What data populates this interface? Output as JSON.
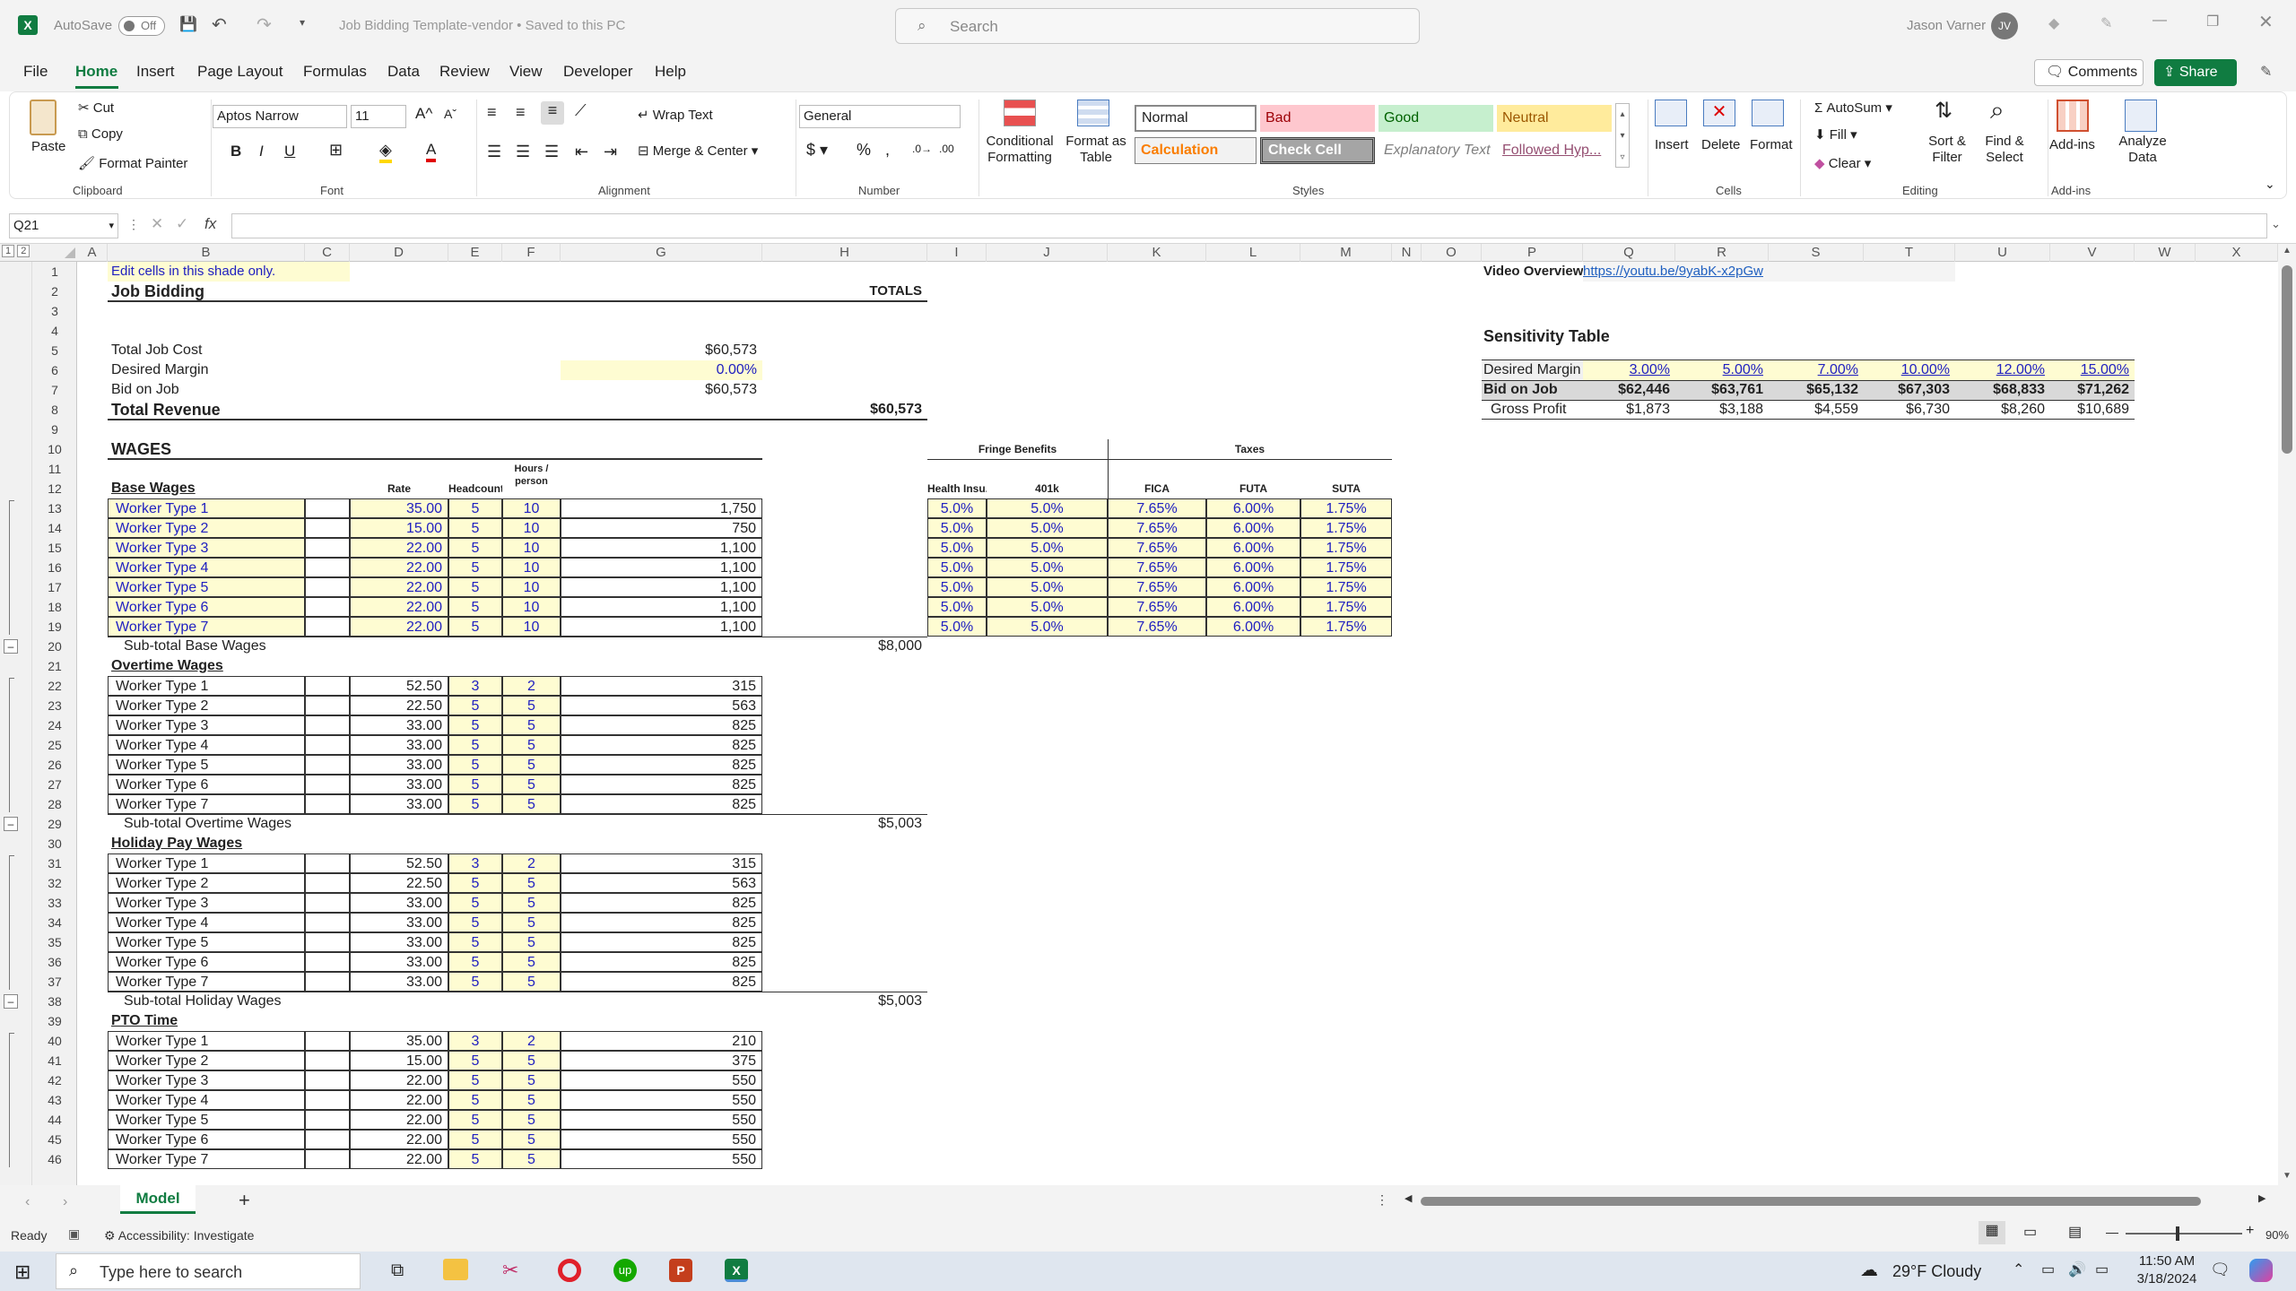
{
  "titlebar": {
    "autosave": "AutoSave",
    "toggle": "Off",
    "doc_title": "Job Bidding Template-vendor • Saved to this PC",
    "search_placeholder": "Search",
    "user": "Jason Varner",
    "initials": "JV"
  },
  "menu": {
    "items": [
      "File",
      "Home",
      "Insert",
      "Page Layout",
      "Formulas",
      "Data",
      "Review",
      "View",
      "Developer",
      "Help"
    ],
    "comments": "Comments",
    "share": "Share"
  },
  "ribbon": {
    "clipboard": {
      "paste": "Paste",
      "cut": "Cut",
      "copy": "Copy",
      "format_painter": "Format Painter",
      "label": "Clipboard"
    },
    "font": {
      "name": "Aptos Narrow",
      "size": "11",
      "label": "Font"
    },
    "alignment": {
      "wrap": "Wrap Text",
      "merge": "Merge & Center",
      "label": "Alignment"
    },
    "number": {
      "format": "General",
      "label": "Number"
    },
    "styles": {
      "cond": "Conditional Formatting",
      "table": "Format as Table",
      "normal": "Normal",
      "bad": "Bad",
      "good": "Good",
      "neutral": "Neutral",
      "calculation": "Calculation",
      "check": "Check Cell",
      "explanatory": "Explanatory Text",
      "followed": "Followed Hyp...",
      "label": "Styles"
    },
    "cells": {
      "insert": "Insert",
      "delete": "Delete",
      "format": "Format",
      "label": "Cells"
    },
    "editing": {
      "autosum": "AutoSum",
      "fill": "Fill",
      "clear": "Clear",
      "sort": "Sort & Filter",
      "find": "Find & Select",
      "label": "Editing"
    },
    "addins": {
      "addins": "Add-ins",
      "analyze": "Analyze Data",
      "label": "Add-ins"
    }
  },
  "formula_bar": {
    "namebox": "Q21",
    "fx": "fx",
    "value": ""
  },
  "columns": [
    "A",
    "B",
    "C",
    "D",
    "E",
    "F",
    "G",
    "H",
    "I",
    "J",
    "K",
    "L",
    "M",
    "N",
    "O",
    "P",
    "Q",
    "R",
    "S",
    "T",
    "U",
    "V",
    "W",
    "X"
  ],
  "rows": [
    1,
    2,
    3,
    4,
    5,
    6,
    7,
    8,
    9,
    10,
    11,
    12,
    13,
    14,
    15,
    16,
    17,
    18,
    19,
    20,
    21,
    22,
    23,
    24,
    25,
    26,
    27,
    28,
    29,
    30,
    31,
    32,
    33,
    34,
    35,
    36,
    37,
    38,
    39,
    40,
    41,
    42,
    43,
    44,
    45,
    46
  ],
  "sheet": {
    "note": "Edit cells in this shade only.",
    "title": "Job Bidding",
    "totals": "TOTALS",
    "total_job_cost_label": "Total Job Cost",
    "total_job_cost": "$60,573",
    "desired_margin_label": "Desired Margin",
    "desired_margin": "0.00%",
    "bid_label": "Bid on Job",
    "bid": "$60,573",
    "total_revenue_label": "Total Revenue",
    "total_revenue": "$60,573",
    "wages": "WAGES",
    "hdr_rate": "Rate",
    "hdr_headcount": "Headcount",
    "hdr_hours": "Hours / person",
    "fringe": "Fringe Benefits",
    "taxes": "Taxes",
    "hdr_health": "Health Insu.",
    "hdr_401k": "401k",
    "hdr_fica": "FICA",
    "hdr_futa": "FUTA",
    "hdr_suta": "SUTA",
    "base_title": "Base Wages",
    "base": [
      [
        "Worker Type 1",
        "35.00",
        "5",
        "10",
        "1,750"
      ],
      [
        "Worker Type 2",
        "15.00",
        "5",
        "10",
        "750"
      ],
      [
        "Worker Type 3",
        "22.00",
        "5",
        "10",
        "1,100"
      ],
      [
        "Worker Type 4",
        "22.00",
        "5",
        "10",
        "1,100"
      ],
      [
        "Worker Type 5",
        "22.00",
        "5",
        "10",
        "1,100"
      ],
      [
        "Worker Type 6",
        "22.00",
        "5",
        "10",
        "1,100"
      ],
      [
        "Worker Type 7",
        "22.00",
        "5",
        "10",
        "1,100"
      ]
    ],
    "benefits": [
      "5.0%",
      "5.0%",
      "7.65%",
      "6.00%",
      "1.75%"
    ],
    "base_sub_label": "Sub-total Base Wages",
    "base_sub": "$8,000",
    "ot_title": "Overtime Wages",
    "ot": [
      [
        "Worker Type 1",
        "52.50",
        "3",
        "2",
        "315"
      ],
      [
        "Worker Type 2",
        "22.50",
        "5",
        "5",
        "563"
      ],
      [
        "Worker Type 3",
        "33.00",
        "5",
        "5",
        "825"
      ],
      [
        "Worker Type 4",
        "33.00",
        "5",
        "5",
        "825"
      ],
      [
        "Worker Type 5",
        "33.00",
        "5",
        "5",
        "825"
      ],
      [
        "Worker Type 6",
        "33.00",
        "5",
        "5",
        "825"
      ],
      [
        "Worker Type 7",
        "33.00",
        "5",
        "5",
        "825"
      ]
    ],
    "ot_sub_label": "Sub-total Overtime Wages",
    "ot_sub": "$5,003",
    "hol_title": "Holiday Pay Wages",
    "hol": [
      [
        "Worker Type 1",
        "52.50",
        "3",
        "2",
        "315"
      ],
      [
        "Worker Type 2",
        "22.50",
        "5",
        "5",
        "563"
      ],
      [
        "Worker Type 3",
        "33.00",
        "5",
        "5",
        "825"
      ],
      [
        "Worker Type 4",
        "33.00",
        "5",
        "5",
        "825"
      ],
      [
        "Worker Type 5",
        "33.00",
        "5",
        "5",
        "825"
      ],
      [
        "Worker Type 6",
        "33.00",
        "5",
        "5",
        "825"
      ],
      [
        "Worker Type 7",
        "33.00",
        "5",
        "5",
        "825"
      ]
    ],
    "hol_sub_label": "Sub-total Holiday Wages",
    "hol_sub": "$5,003",
    "pto_title": "PTO Time",
    "pto": [
      [
        "Worker Type 1",
        "35.00",
        "3",
        "2",
        "210"
      ],
      [
        "Worker Type 2",
        "15.00",
        "5",
        "5",
        "375"
      ],
      [
        "Worker Type 3",
        "22.00",
        "5",
        "5",
        "550"
      ],
      [
        "Worker Type 4",
        "22.00",
        "5",
        "5",
        "550"
      ],
      [
        "Worker Type 5",
        "22.00",
        "5",
        "5",
        "550"
      ],
      [
        "Worker Type 6",
        "22.00",
        "5",
        "5",
        "550"
      ],
      [
        "Worker Type 7",
        "22.00",
        "5",
        "5",
        "550"
      ]
    ],
    "video_label": "Video Overview:",
    "video_link": "https://youtu.be/9yabK-x2pGw",
    "sens_title": "Sensitivity Table",
    "sens_margin_label": "Desired Margin",
    "sens_margins": [
      "3.00%",
      "5.00%",
      "7.00%",
      "10.00%",
      "12.00%",
      "15.00%"
    ],
    "sens_bid_label": "Bid on Job",
    "sens_bids": [
      "$62,446",
      "$63,761",
      "$65,132",
      "$67,303",
      "$68,833",
      "$71,262"
    ],
    "sens_gp_label": "Gross Profit",
    "sens_gps": [
      "$1,873",
      "$3,188",
      "$4,559",
      "$6,730",
      "$8,260",
      "$10,689"
    ]
  },
  "statusbar": {
    "sheet_tab": "Model",
    "ready": "Ready",
    "accessibility": "Accessibility: Investigate",
    "zoom": "90%"
  },
  "taskbar": {
    "search": "Type here to search",
    "weather": "29°F  Cloudy",
    "time": "11:50 AM",
    "date": "3/18/2024"
  }
}
